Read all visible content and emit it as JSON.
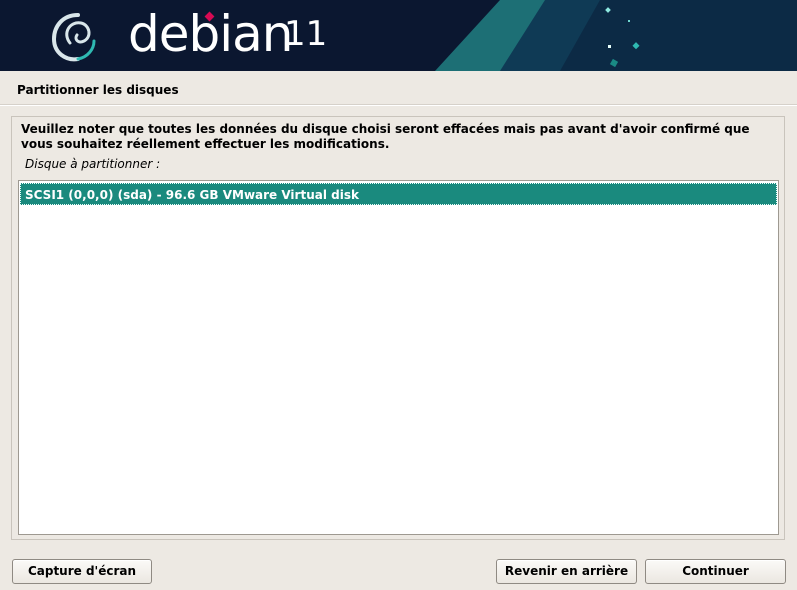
{
  "header": {
    "brand": "debian",
    "version": "11",
    "colors": {
      "background": "#0b1730",
      "accent": "#d70a53",
      "teal": "#1f8a86"
    }
  },
  "page": {
    "title": "Partitionner les disques"
  },
  "content": {
    "warning": "Veuillez noter que toutes les données du disque choisi seront effacées mais pas avant d'avoir confirmé que vous souhaitez réellement effectuer les modifications.",
    "list_label": "Disque à partitionner :",
    "disks": [
      {
        "label": "SCSI1 (0,0,0) (sda) - 96.6 GB VMware Virtual disk",
        "selected": true
      }
    ],
    "selection_color": "#1a8a7e"
  },
  "buttons": {
    "screenshot": "Capture d'écran",
    "back": "Revenir en arrière",
    "continue": "Continuer"
  }
}
